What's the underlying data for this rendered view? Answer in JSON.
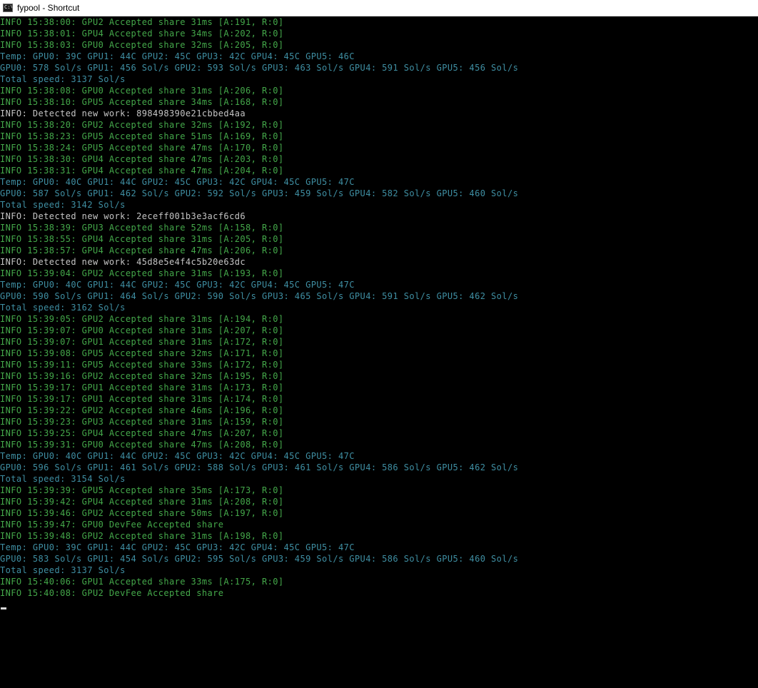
{
  "window": {
    "title": "fypool - Shortcut",
    "icon": "console-icon"
  },
  "colors": {
    "share": "#44a84a",
    "work": "#c4c4c4",
    "stats": "#3f8fa3",
    "background": "#000000"
  },
  "console": {
    "lines": [
      {
        "kind": "share",
        "text": "INFO 15:38:00: GPU2 Accepted share 31ms [A:191, R:0]"
      },
      {
        "kind": "share",
        "text": "INFO 15:38:01: GPU4 Accepted share 34ms [A:202, R:0]"
      },
      {
        "kind": "share",
        "text": "INFO 15:38:03: GPU0 Accepted share 32ms [A:205, R:0]"
      },
      {
        "kind": "stats",
        "text": "Temp: GPU0: 39C GPU1: 44C GPU2: 45C GPU3: 42C GPU4: 45C GPU5: 46C"
      },
      {
        "kind": "stats",
        "text": "GPU0: 578 Sol/s GPU1: 456 Sol/s GPU2: 593 Sol/s GPU3: 463 Sol/s GPU4: 591 Sol/s GPU5: 456 Sol/s"
      },
      {
        "kind": "stats",
        "text": "Total speed: 3137 Sol/s"
      },
      {
        "kind": "share",
        "text": "INFO 15:38:08: GPU0 Accepted share 31ms [A:206, R:0]"
      },
      {
        "kind": "share",
        "text": "INFO 15:38:10: GPU5 Accepted share 34ms [A:168, R:0]"
      },
      {
        "kind": "work",
        "text": "INFO: Detected new work: 898498390e21cbbed4aa"
      },
      {
        "kind": "share",
        "text": "INFO 15:38:20: GPU2 Accepted share 32ms [A:192, R:0]"
      },
      {
        "kind": "share",
        "text": "INFO 15:38:23: GPU5 Accepted share 51ms [A:169, R:0]"
      },
      {
        "kind": "share",
        "text": "INFO 15:38:24: GPU5 Accepted share 47ms [A:170, R:0]"
      },
      {
        "kind": "share",
        "text": "INFO 15:38:30: GPU4 Accepted share 47ms [A:203, R:0]"
      },
      {
        "kind": "share",
        "text": "INFO 15:38:31: GPU4 Accepted share 47ms [A:204, R:0]"
      },
      {
        "kind": "stats",
        "text": "Temp: GPU0: 40C GPU1: 44C GPU2: 45C GPU3: 42C GPU4: 45C GPU5: 47C"
      },
      {
        "kind": "stats",
        "text": "GPU0: 587 Sol/s GPU1: 462 Sol/s GPU2: 592 Sol/s GPU3: 459 Sol/s GPU4: 582 Sol/s GPU5: 460 Sol/s"
      },
      {
        "kind": "stats",
        "text": "Total speed: 3142 Sol/s"
      },
      {
        "kind": "work",
        "text": "INFO: Detected new work: 2eceff001b3e3acf6cd6"
      },
      {
        "kind": "share",
        "text": "INFO 15:38:39: GPU3 Accepted share 52ms [A:158, R:0]"
      },
      {
        "kind": "share",
        "text": "INFO 15:38:55: GPU4 Accepted share 31ms [A:205, R:0]"
      },
      {
        "kind": "share",
        "text": "INFO 15:38:57: GPU4 Accepted share 47ms [A:206, R:0]"
      },
      {
        "kind": "work",
        "text": "INFO: Detected new work: 45d8e5e4f4c5b20e63dc"
      },
      {
        "kind": "share",
        "text": "INFO 15:39:04: GPU2 Accepted share 31ms [A:193, R:0]"
      },
      {
        "kind": "stats",
        "text": "Temp: GPU0: 40C GPU1: 44C GPU2: 45C GPU3: 42C GPU4: 45C GPU5: 47C"
      },
      {
        "kind": "stats",
        "text": "GPU0: 590 Sol/s GPU1: 464 Sol/s GPU2: 590 Sol/s GPU3: 465 Sol/s GPU4: 591 Sol/s GPU5: 462 Sol/s"
      },
      {
        "kind": "stats",
        "text": "Total speed: 3162 Sol/s"
      },
      {
        "kind": "share",
        "text": "INFO 15:39:05: GPU2 Accepted share 31ms [A:194, R:0]"
      },
      {
        "kind": "share",
        "text": "INFO 15:39:07: GPU0 Accepted share 31ms [A:207, R:0]"
      },
      {
        "kind": "share",
        "text": "INFO 15:39:07: GPU1 Accepted share 31ms [A:172, R:0]"
      },
      {
        "kind": "share",
        "text": "INFO 15:39:08: GPU5 Accepted share 32ms [A:171, R:0]"
      },
      {
        "kind": "share",
        "text": "INFO 15:39:11: GPU5 Accepted share 33ms [A:172, R:0]"
      },
      {
        "kind": "share",
        "text": "INFO 15:39:16: GPU2 Accepted share 32ms [A:195, R:0]"
      },
      {
        "kind": "share",
        "text": "INFO 15:39:17: GPU1 Accepted share 31ms [A:173, R:0]"
      },
      {
        "kind": "share",
        "text": "INFO 15:39:17: GPU1 Accepted share 31ms [A:174, R:0]"
      },
      {
        "kind": "share",
        "text": "INFO 15:39:22: GPU2 Accepted share 46ms [A:196, R:0]"
      },
      {
        "kind": "share",
        "text": "INFO 15:39:23: GPU3 Accepted share 31ms [A:159, R:0]"
      },
      {
        "kind": "share",
        "text": "INFO 15:39:25: GPU4 Accepted share 47ms [A:207, R:0]"
      },
      {
        "kind": "share",
        "text": "INFO 15:39:31: GPU0 Accepted share 47ms [A:208, R:0]"
      },
      {
        "kind": "stats",
        "text": "Temp: GPU0: 40C GPU1: 44C GPU2: 45C GPU3: 42C GPU4: 45C GPU5: 47C"
      },
      {
        "kind": "stats",
        "text": "GPU0: 596 Sol/s GPU1: 461 Sol/s GPU2: 588 Sol/s GPU3: 461 Sol/s GPU4: 586 Sol/s GPU5: 462 Sol/s"
      },
      {
        "kind": "stats",
        "text": "Total speed: 3154 Sol/s"
      },
      {
        "kind": "share",
        "text": "INFO 15:39:39: GPU5 Accepted share 35ms [A:173, R:0]"
      },
      {
        "kind": "share",
        "text": "INFO 15:39:42: GPU4 Accepted share 31ms [A:208, R:0]"
      },
      {
        "kind": "share",
        "text": "INFO 15:39:46: GPU2 Accepted share 50ms [A:197, R:0]"
      },
      {
        "kind": "share",
        "text": "INFO 15:39:47: GPU0 DevFee Accepted share"
      },
      {
        "kind": "share",
        "text": "INFO 15:39:48: GPU2 Accepted share 31ms [A:198, R:0]"
      },
      {
        "kind": "stats",
        "text": "Temp: GPU0: 39C GPU1: 44C GPU2: 45C GPU3: 42C GPU4: 45C GPU5: 47C"
      },
      {
        "kind": "stats",
        "text": "GPU0: 583 Sol/s GPU1: 454 Sol/s GPU2: 595 Sol/s GPU3: 459 Sol/s GPU4: 586 Sol/s GPU5: 460 Sol/s"
      },
      {
        "kind": "stats",
        "text": "Total speed: 3137 Sol/s"
      },
      {
        "kind": "share",
        "text": "INFO 15:40:06: GPU1 Accepted share 33ms [A:175, R:0]"
      },
      {
        "kind": "share",
        "text": "INFO 15:40:08: GPU2 DevFee Accepted share"
      }
    ]
  }
}
